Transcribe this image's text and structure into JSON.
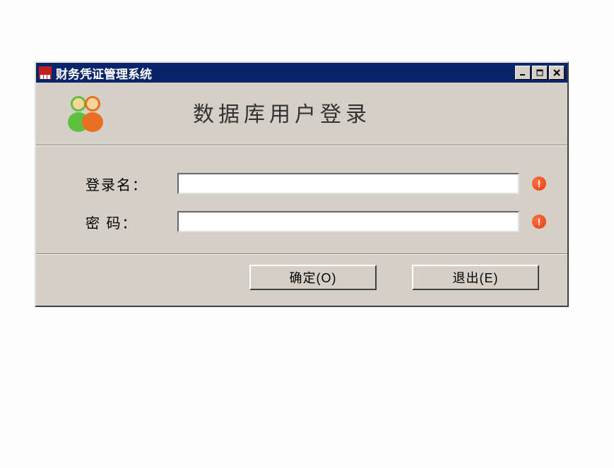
{
  "window": {
    "title": "财务凭证管理系统"
  },
  "header": {
    "title": "数据库用户登录"
  },
  "form": {
    "username_label": "登录名：",
    "username_value": "",
    "password_label": "密  码：",
    "password_value": ""
  },
  "buttons": {
    "ok_label": "确定(O)",
    "exit_label": "退出(E)"
  }
}
